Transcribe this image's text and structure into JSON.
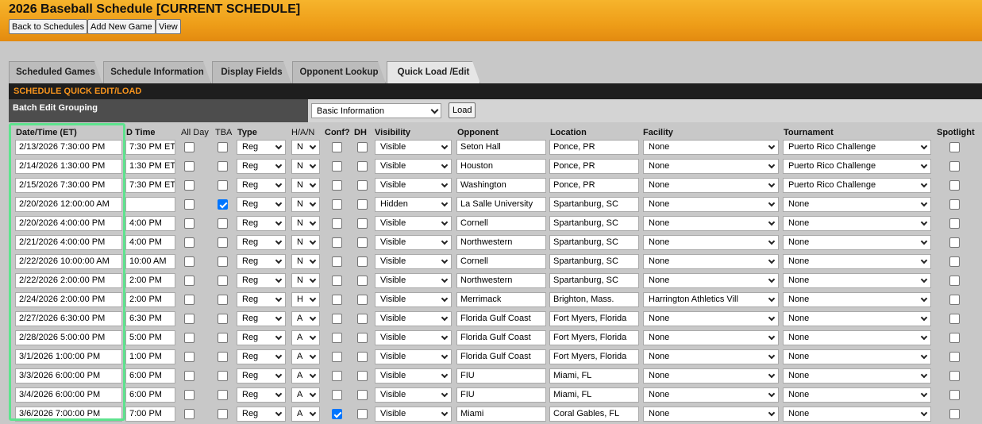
{
  "page": {
    "title": "2026 Baseball Schedule [CURRENT SCHEDULE]",
    "buttons": [
      "Back to Schedules",
      "Add New Game",
      "View"
    ]
  },
  "tabs": [
    "Scheduled Games",
    "Schedule Information",
    "Display Fields",
    "Opponent Lookup",
    "Quick Load /Edit"
  ],
  "active_tab": "Quick Load /Edit",
  "section": {
    "title": "SCHEDULE QUICK EDIT/LOAD",
    "batch_label": "Batch Edit Grouping",
    "batch_value": "Basic Information",
    "load_label": "Load"
  },
  "columns": {
    "datetime": "Date/Time (ET)",
    "dtime": "D Time",
    "allday": "All Day",
    "tba": "TBA",
    "type": "Type",
    "han": "H/A/N",
    "conf": "Conf?",
    "dh": "DH",
    "visibility": "Visibility",
    "opponent": "Opponent",
    "location": "Location",
    "facility": "Facility",
    "tournament": "Tournament",
    "spotlight": "Spotlight"
  },
  "games": [
    {
      "datetime": "2/13/2026 7:30:00 PM",
      "dtime": "7:30 PM ET",
      "allday": false,
      "tba": false,
      "type": "Reg",
      "han": "N",
      "conf": false,
      "dh": false,
      "visibility": "Visible",
      "opponent": "Seton Hall",
      "location": "Ponce, PR",
      "facility": "None",
      "tournament": "Puerto Rico Challenge",
      "spotlight": false
    },
    {
      "datetime": "2/14/2026 1:30:00 PM",
      "dtime": "1:30 PM ET",
      "allday": false,
      "tba": false,
      "type": "Reg",
      "han": "N",
      "conf": false,
      "dh": false,
      "visibility": "Visible",
      "opponent": "Houston",
      "location": "Ponce, PR",
      "facility": "None",
      "tournament": "Puerto Rico Challenge",
      "spotlight": false
    },
    {
      "datetime": "2/15/2026 7:30:00 PM",
      "dtime": "7:30 PM ET",
      "allday": false,
      "tba": false,
      "type": "Reg",
      "han": "N",
      "conf": false,
      "dh": false,
      "visibility": "Visible",
      "opponent": "Washington",
      "location": "Ponce, PR",
      "facility": "None",
      "tournament": "Puerto Rico Challenge",
      "spotlight": false
    },
    {
      "datetime": "2/20/2026 12:00:00 AM",
      "dtime": "",
      "allday": false,
      "tba": true,
      "type": "Reg",
      "han": "N",
      "conf": false,
      "dh": false,
      "visibility": "Hidden",
      "opponent": "La Salle University",
      "location": "Spartanburg, SC",
      "facility": "None",
      "tournament": "None",
      "spotlight": false
    },
    {
      "datetime": "2/20/2026 4:00:00 PM",
      "dtime": "4:00 PM",
      "allday": false,
      "tba": false,
      "type": "Reg",
      "han": "N",
      "conf": false,
      "dh": false,
      "visibility": "Visible",
      "opponent": "Cornell",
      "location": "Spartanburg, SC",
      "facility": "None",
      "tournament": "None",
      "spotlight": false
    },
    {
      "datetime": "2/21/2026 4:00:00 PM",
      "dtime": "4:00 PM",
      "allday": false,
      "tba": false,
      "type": "Reg",
      "han": "N",
      "conf": false,
      "dh": false,
      "visibility": "Visible",
      "opponent": "Northwestern",
      "location": "Spartanburg, SC",
      "facility": "None",
      "tournament": "None",
      "spotlight": false
    },
    {
      "datetime": "2/22/2026 10:00:00 AM",
      "dtime": "10:00 AM",
      "allday": false,
      "tba": false,
      "type": "Reg",
      "han": "N",
      "conf": false,
      "dh": false,
      "visibility": "Visible",
      "opponent": "Cornell",
      "location": "Spartanburg, SC",
      "facility": "None",
      "tournament": "None",
      "spotlight": false
    },
    {
      "datetime": "2/22/2026 2:00:00 PM",
      "dtime": "2:00 PM",
      "allday": false,
      "tba": false,
      "type": "Reg",
      "han": "N",
      "conf": false,
      "dh": false,
      "visibility": "Visible",
      "opponent": "Northwestern",
      "location": "Spartanburg, SC",
      "facility": "None",
      "tournament": "None",
      "spotlight": false
    },
    {
      "datetime": "2/24/2026 2:00:00 PM",
      "dtime": "2:00 PM",
      "allday": false,
      "tba": false,
      "type": "Reg",
      "han": "H",
      "conf": false,
      "dh": false,
      "visibility": "Visible",
      "opponent": "Merrimack",
      "location": "Brighton, Mass.",
      "facility": "Harrington Athletics Vill",
      "tournament": "None",
      "spotlight": false
    },
    {
      "datetime": "2/27/2026 6:30:00 PM",
      "dtime": "6:30 PM",
      "allday": false,
      "tba": false,
      "type": "Reg",
      "han": "A",
      "conf": false,
      "dh": false,
      "visibility": "Visible",
      "opponent": "Florida Gulf Coast",
      "location": "Fort Myers, Florida",
      "facility": "None",
      "tournament": "None",
      "spotlight": false
    },
    {
      "datetime": "2/28/2026 5:00:00 PM",
      "dtime": "5:00 PM",
      "allday": false,
      "tba": false,
      "type": "Reg",
      "han": "A",
      "conf": false,
      "dh": false,
      "visibility": "Visible",
      "opponent": "Florida Gulf Coast",
      "location": "Fort Myers, Florida",
      "facility": "None",
      "tournament": "None",
      "spotlight": false
    },
    {
      "datetime": "3/1/2026 1:00:00 PM",
      "dtime": "1:00 PM",
      "allday": false,
      "tba": false,
      "type": "Reg",
      "han": "A",
      "conf": false,
      "dh": false,
      "visibility": "Visible",
      "opponent": "Florida Gulf Coast",
      "location": "Fort Myers, Florida",
      "facility": "None",
      "tournament": "None",
      "spotlight": false
    },
    {
      "datetime": "3/3/2026 6:00:00 PM",
      "dtime": "6:00 PM",
      "allday": false,
      "tba": false,
      "type": "Reg",
      "han": "A",
      "conf": false,
      "dh": false,
      "visibility": "Visible",
      "opponent": "FIU",
      "location": "Miami, FL",
      "facility": "None",
      "tournament": "None",
      "spotlight": false
    },
    {
      "datetime": "3/4/2026 6:00:00 PM",
      "dtime": "6:00 PM",
      "allday": false,
      "tba": false,
      "type": "Reg",
      "han": "A",
      "conf": false,
      "dh": false,
      "visibility": "Visible",
      "opponent": "FIU",
      "location": "Miami, FL",
      "facility": "None",
      "tournament": "None",
      "spotlight": false
    },
    {
      "datetime": "3/6/2026 7:00:00 PM",
      "dtime": "7:00 PM",
      "allday": false,
      "tba": false,
      "type": "Reg",
      "han": "A",
      "conf": true,
      "dh": false,
      "visibility": "Visible",
      "opponent": "Miami",
      "location": "Coral Gables, FL",
      "facility": "None",
      "tournament": "None",
      "spotlight": false
    }
  ],
  "colors": {
    "header_orange": "#f0a020",
    "section_title": "#f7941d",
    "highlight": "#5ee38e",
    "checkbox_on": "#0075ff"
  }
}
